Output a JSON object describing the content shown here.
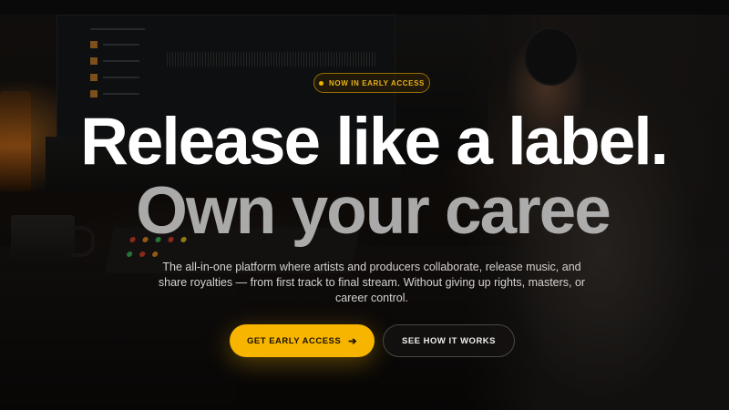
{
  "badge": {
    "label": "NOW IN EARLY ACCESS"
  },
  "hero": {
    "headline_1": "Release like a label.",
    "headline_2": "Own your caree",
    "subtitle": "The all-in-one platform where artists and producers collaborate, release music, and share royalties — from first track to final stream. Without giving up rights, masters, or career control."
  },
  "cta": {
    "primary_label": "GET EARLY ACCESS",
    "primary_icon": "arrow-right",
    "secondary_label": "SEE HOW IT WORKS"
  },
  "colors": {
    "accent": "#f7b500",
    "headline": "#ffffff",
    "headline_muted": "#cdcdcd",
    "background": "#0b0908"
  }
}
